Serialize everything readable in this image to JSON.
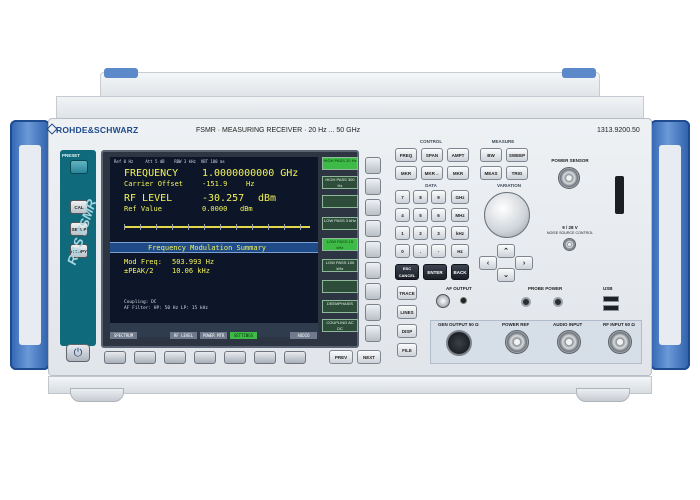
{
  "header": {
    "brand": "ROHDE&SCHWARZ",
    "model_line": "FSMR · MEASURING RECEIVER · 20 Hz ... 50 GHz",
    "serial": "1313.9200.50"
  },
  "logo_text": "R&S FSMR",
  "display": {
    "top_bar": [
      "Ref  0 Hz",
      "Att  5 dB",
      "RBW 3 kHz",
      "VBT 100 ms"
    ],
    "freq_label": "FREQUENCY",
    "freq_value": "1.0000000000 GHz",
    "carrier_label": "Carrier Offset",
    "carrier_value": "-151.9",
    "carrier_unit": "Hz",
    "rflevel_label": "RF LEVEL",
    "rflevel_value": "-30.257",
    "rflevel_unit": "dBm",
    "ref_label": "Ref Value",
    "ref_value": "0.0000",
    "ref_unit": "dBm",
    "summary_title": "Frequency Modulation Summary",
    "mod_freq_label": "Mod Freq:",
    "mod_freq_value": "503.993 Hz",
    "peak_label": "±PEAK/2",
    "peak_value": "10.06 kHz",
    "coupling": "Coupling: DC",
    "filter": "AF Filter: HP: 50 Hz    LP: 15 kHz",
    "softkeys": [
      "HIGH PASS 20 Hz",
      "HIGH PASS 300 Hz",
      "",
      "LOW PASS 3 kHz",
      "LOW PASS 15 kHz",
      "LOW PASS 100 kHz",
      "",
      "DEEMPHASIS",
      "COUPLING AC DC"
    ],
    "hotkeys": [
      "SPECTRUM",
      "",
      "RF LEVEL",
      "POWER MTR",
      "SETTINGS",
      "",
      "AUDIO"
    ]
  },
  "left_keys": [
    "PRESET",
    "CAL",
    "SETUP",
    "HCOPY"
  ],
  "bottom_nav": {
    "prev": "PREV",
    "next": "NEXT"
  },
  "control": {
    "label": "CONTROL",
    "keys": [
      "FREQ",
      "SPAN",
      "AMPT",
      "MKR",
      "MKR→",
      "MKR FCTN"
    ]
  },
  "measure": {
    "label": "MEASURE",
    "keys": [
      "BW",
      "SWEEP",
      "MEAS",
      "TRIG"
    ]
  },
  "data": {
    "label": "DATA",
    "digits": [
      "7",
      "8",
      "9",
      "4",
      "5",
      "6",
      "1",
      "2",
      "3",
      "0",
      ".",
      "-"
    ],
    "units": [
      "GHz",
      "MHz",
      "kHz",
      "Hz"
    ],
    "esc": "ESC CANCEL",
    "enter": "ENTER",
    "back": "BACK"
  },
  "variation_label": "VARIATION",
  "side_keys": [
    "TRACE",
    "LINES",
    "DISP",
    "FILE"
  ],
  "power_sensor": {
    "label": "POWER SENSOR",
    "volt": "9 / 28 V",
    "note": "NOISE SOURCE CONTROL"
  },
  "connectors": {
    "af_output": "AF OUTPUT",
    "probe_power": "PROBE POWER",
    "usb": "USB",
    "gen_output": "GEN OUTPUT 50 Ω",
    "power_ref": "POWER REF",
    "audio_input": "AUDIO INPUT",
    "rf_input": "RF INPUT 50 Ω"
  }
}
